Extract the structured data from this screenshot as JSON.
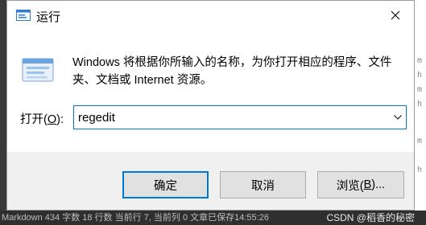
{
  "window": {
    "title": "运行",
    "close_icon": "close-icon"
  },
  "dialog": {
    "description": "Windows 将根据你所输入的名称，为你打开相应的程序、文件夹、文档或 Internet 资源。",
    "open_label_prefix": "打开(",
    "open_label_accel": "O",
    "open_label_suffix": "):",
    "command_value": "regedit"
  },
  "buttons": {
    "ok": "确定",
    "cancel": "取消",
    "browse_prefix": "浏览(",
    "browse_accel": "B",
    "browse_suffix": ")..."
  },
  "background": {
    "status_text": "Markdown  434 字数  18 行数  当前行 7, 当前列 0  文章已保存14:55:26",
    "watermark": "CSDN @稻香的秘密",
    "edge_marks": [
      "m",
      "h",
      "m",
      "h",
      "m",
      "h"
    ]
  },
  "colors": {
    "accent": "#0078d7",
    "dialog_bg": "#f0f0f0",
    "content_bg": "#ffffff",
    "button_bg": "#e1e1e1"
  }
}
